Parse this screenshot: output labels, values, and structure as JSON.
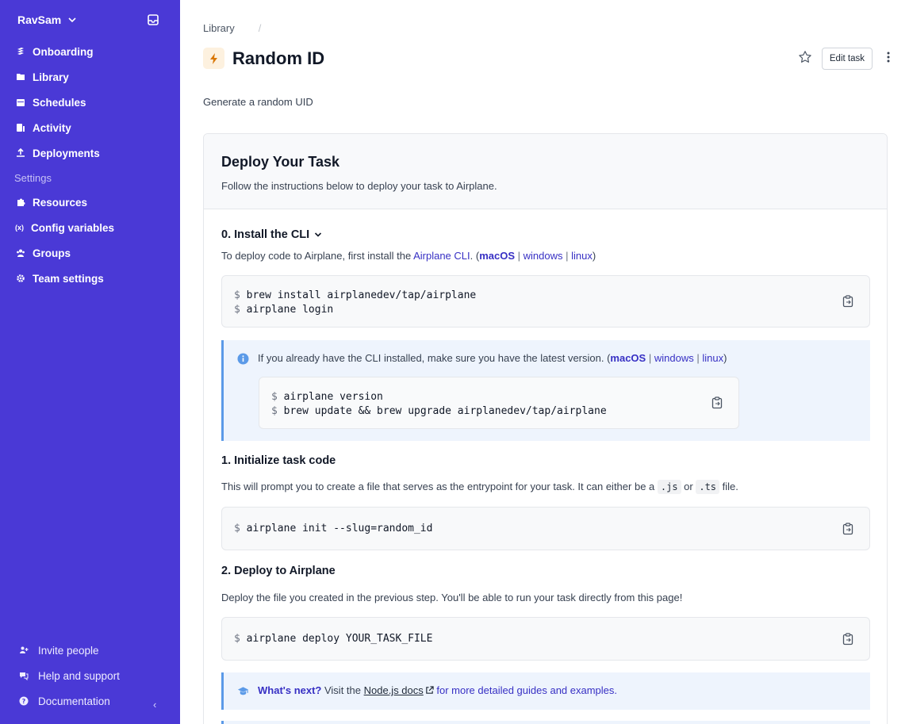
{
  "sidebar": {
    "workspace": "RavSam",
    "nav": [
      {
        "label": "Onboarding",
        "icon": "onboarding-icon"
      },
      {
        "label": "Library",
        "icon": "library-icon"
      },
      {
        "label": "Schedules",
        "icon": "calendar-icon"
      },
      {
        "label": "Activity",
        "icon": "activity-icon"
      },
      {
        "label": "Deployments",
        "icon": "upload-icon"
      }
    ],
    "settings_label": "Settings",
    "settings": [
      {
        "label": "Resources",
        "icon": "puzzle-icon"
      },
      {
        "label": "Config variables",
        "icon": "variable-icon",
        "glyph": "(x)"
      },
      {
        "label": "Groups",
        "icon": "users-icon"
      },
      {
        "label": "Team settings",
        "icon": "gear-icon"
      }
    ],
    "footer": [
      {
        "label": "Invite people",
        "icon": "user-plus-icon"
      },
      {
        "label": "Help and support",
        "icon": "chat-icon"
      },
      {
        "label": "Documentation",
        "icon": "question-icon"
      }
    ]
  },
  "header": {
    "breadcrumb": "Library",
    "breadcrumb_sep": "/",
    "title": "Random ID",
    "edit_label": "Edit task",
    "description": "Generate a random UID"
  },
  "deploy": {
    "heading": "Deploy Your Task",
    "subheading": "Follow the instructions below to deploy your task to Airplane.",
    "step0": {
      "title": "0. Install the CLI",
      "text_before": "To deploy code to Airplane, first install the ",
      "cli_link": "Airplane CLI",
      "text_mid": ". (",
      "macos": "macOS",
      "sep": "|",
      "windows": "windows",
      "linux": "linux",
      "text_end": ")",
      "cmd1": "brew install airplanedev/tap/airplane",
      "cmd2": "airplane login",
      "prompt": "$"
    },
    "info": {
      "text": "If you already have the CLI installed, make sure you have the latest version. (",
      "end": ")",
      "cmd1": "airplane version",
      "cmd2": "brew update && brew upgrade airplanedev/tap/airplane"
    },
    "step1": {
      "title": "1. Initialize task code",
      "text_before": "This will prompt you to create a file that serves as the entrypoint for your task. It can either be a ",
      "js": ".js",
      "or": " or ",
      "ts": ".ts",
      "text_end": " file.",
      "cmd": "airplane init --slug=random_id"
    },
    "step2": {
      "title": "2. Deploy to Airplane",
      "text": "Deploy the file you created in the previous step. You'll be able to run your task directly from this page!",
      "cmd": "airplane deploy YOUR_TASK_FILE"
    },
    "next": {
      "label": "What's next?",
      "text_before": " Visit the ",
      "link": "Node.js docs",
      "text_after": " for more detailed guides and examples."
    }
  }
}
